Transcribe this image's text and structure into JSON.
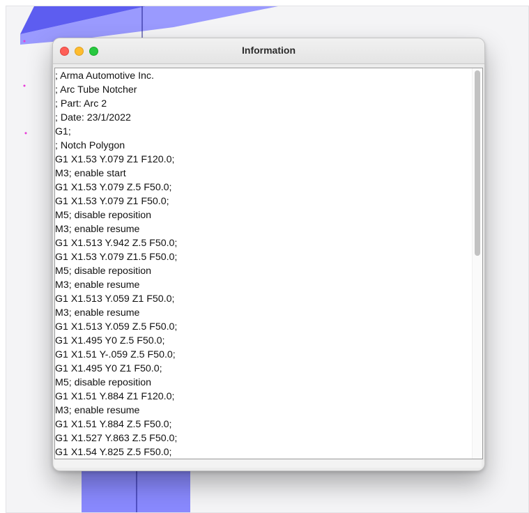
{
  "window": {
    "title": "Information"
  },
  "content": {
    "lines": [
      "; Arma Automotive Inc.",
      "; Arc Tube Notcher",
      "; Part: Arc 2",
      "; Date: 23/1/2022",
      "G1;",
      "; Notch Polygon",
      "G1 X1.53 Y.079 Z1 F120.0;",
      "M3; enable start",
      "G1 X1.53 Y.079 Z.5 F50.0;",
      "G1 X1.53 Y.079 Z1 F50.0;",
      "M5; disable reposition",
      "M3; enable resume",
      "G1 X1.513 Y.942 Z.5 F50.0;",
      "G1 X1.53 Y.079 Z1.5 F50.0;",
      "M5; disable reposition",
      "M3; enable resume",
      "G1 X1.513 Y.059 Z1 F50.0;",
      "M3; enable resume",
      "G1 X1.513 Y.059 Z.5 F50.0;",
      "G1 X1.495 Y0 Z.5 F50.0;",
      "G1 X1.51 Y-.059 Z.5 F50.0;",
      "G1 X1.495 Y0 Z1 F50.0;",
      "M5; disable reposition",
      "G1 X1.51 Y.884 Z1 F120.0;",
      "M3; enable resume",
      "G1 X1.51 Y.884 Z.5 F50.0;",
      "G1 X1.527 Y.863 Z.5 F50.0;",
      "G1 X1.54 Y.825 Z.5 F50.0;"
    ]
  },
  "colors": {
    "shape_fill": "#8a8aff",
    "shape_dark": "#4242ee",
    "close": "#fe5f57",
    "minimize": "#febc2e",
    "zoom": "#28c840"
  }
}
